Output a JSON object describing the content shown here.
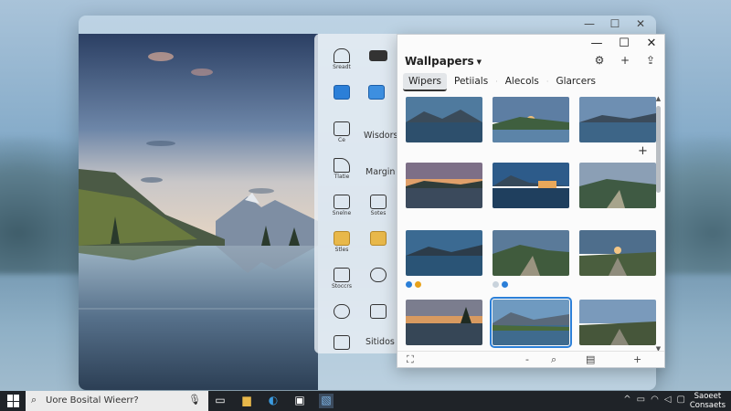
{
  "window_controls": {
    "minimize": "—",
    "maximize": "☐",
    "close": "✕"
  },
  "icon_panel": {
    "rows": [
      {
        "left_caption": "Sreadt",
        "right_label": ""
      },
      {
        "left_caption": "",
        "right_label": ""
      },
      {
        "left_caption": "Ce",
        "right_label": "Wisdors"
      },
      {
        "left_caption": "Tlatie",
        "right_label": "Margin"
      },
      {
        "left_caption": "Snelne",
        "right_label": "Sotes"
      },
      {
        "left_caption": "Stles",
        "right_label": ""
      },
      {
        "left_caption": "Stoccrs",
        "right_label": ""
      },
      {
        "left_caption": "",
        "right_label": ""
      },
      {
        "left_caption": "",
        "right_label": "Sitidos"
      }
    ]
  },
  "wallpapers": {
    "title": "Wallpapers",
    "tabs": [
      "Wipers",
      "Petiials",
      "Alecols",
      "Glarcers"
    ],
    "active_tab": "Wipers",
    "controls": {
      "minimize": "—",
      "maximize": "☐",
      "close": "✕"
    },
    "actions": {
      "settings": "⚙",
      "add": "+",
      "export": "⇪"
    },
    "grid_add": "+",
    "bottom": {
      "left_icon": "⛶",
      "minus": "-",
      "search": "⌕",
      "page_icon": "▤",
      "add": "+"
    }
  },
  "taskbar": {
    "search_placeholder": "Uore Bosital Wieerr?",
    "clock_line1": "Saoeet",
    "clock_line2": "Consaets"
  },
  "colors": {
    "accent": "#2b7fd8",
    "taskbar": "#1f2328"
  }
}
